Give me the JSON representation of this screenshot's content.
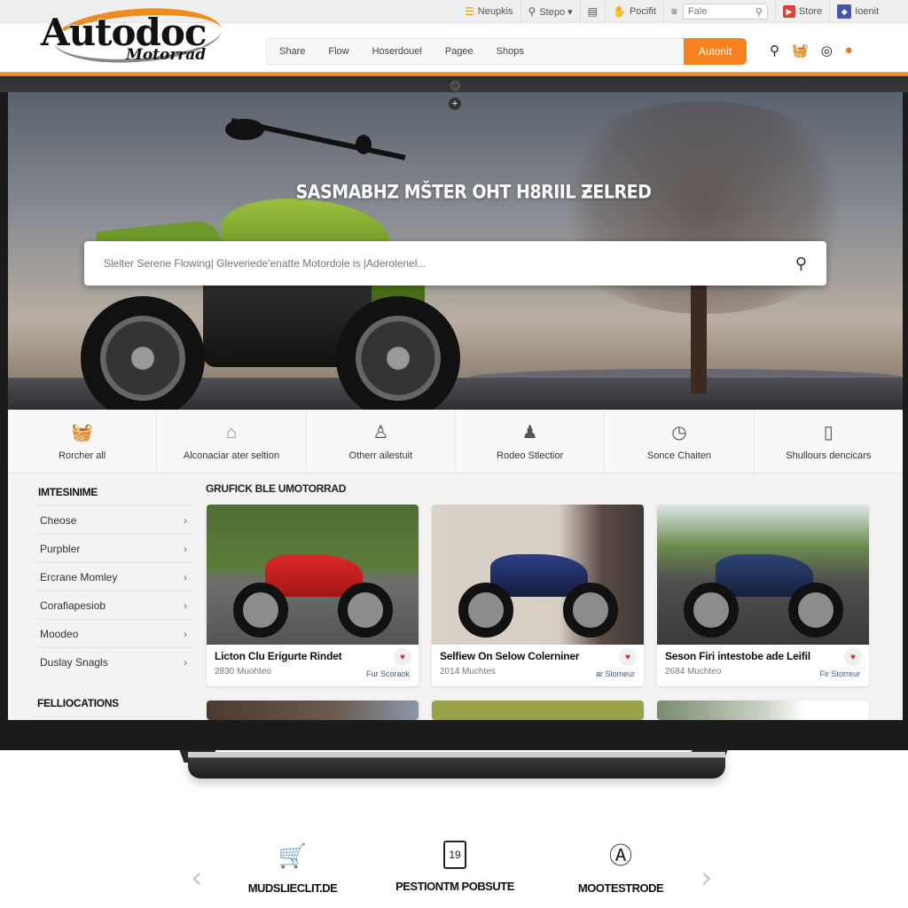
{
  "brand": {
    "name": "Autodoc",
    "subname": "Motorrad",
    "accent": "#f4831f"
  },
  "utility_bar": {
    "items": [
      {
        "icon": "list-icon",
        "label": "Neupkis"
      },
      {
        "icon": "search-icon",
        "label": "Stepo ▾"
      },
      {
        "icon": "card-icon",
        "label": ""
      },
      {
        "icon": "hand-icon",
        "label": "Pocifit"
      },
      {
        "icon": "menu-icon",
        "label": ""
      }
    ],
    "search": {
      "value": "Fale",
      "icon": "search-icon"
    },
    "store_label": "Store",
    "account_label": "Ioenit"
  },
  "header": {
    "nav": [
      "Share",
      "Flow",
      "Hoserdouel",
      "Pagee",
      "Shops"
    ],
    "cta_label": "Autonit",
    "icons": [
      "search-icon",
      "basket-icon",
      "user-badge-icon",
      "helmet-icon"
    ]
  },
  "hero": {
    "title": "SASMABHZ MŠTER OHT H8RIIL ƵELRED",
    "search_placeholder": "Slelter Serene Flowing| Gleveriede'enatte Motordole is |Aderolenel..."
  },
  "quick_links": [
    {
      "icon": "basket-icon",
      "label": "Rorcher all"
    },
    {
      "icon": "house-icon",
      "label": "Alconaciar ater seltion"
    },
    {
      "icon": "user-outline-icon",
      "label": "Otherr ailestuit"
    },
    {
      "icon": "user-filled-icon",
      "label": "Rodeo Stlectior"
    },
    {
      "icon": "clock-icon",
      "label": "Sonce Chaiten"
    },
    {
      "icon": "phone-icon",
      "label": "Shullours dencicars"
    }
  ],
  "sidebar": {
    "heading": "IMTESINIME",
    "items": [
      "Cheose",
      "Purpbler",
      "Ercrane Momley",
      "Corafiapesiob",
      "Moodeo",
      "Duslay Snagls"
    ],
    "heading2": "FELLIOCATIONS"
  },
  "grid": {
    "title": "GRUFICK BLE UMOTORRAD",
    "cards": [
      {
        "title": "Licton Clu Erigurte Rindet",
        "subtitle": "2830 Muohteo",
        "link": "Fur Scoraok",
        "image": "red-sport-motorcycle"
      },
      {
        "title": "Selfiew On Selow Colerniner",
        "subtitle": "2014 Muchtes",
        "link": "ar Slomeur",
        "image": "blue-naked-motorcycle-garage"
      },
      {
        "title": "Seson Firi intestobe ade Leifil",
        "subtitle": "2684 Muchteo",
        "link": "Fir Storreur",
        "image": "blue-retro-motorcycle-road"
      }
    ]
  },
  "features": [
    {
      "icon": "cart-icon",
      "label": "MUDSLIECLIT.DE"
    },
    {
      "icon": "calendar-icon",
      "label": "PESTIONTM POBSUTE",
      "icon_text": "19"
    },
    {
      "icon": "emblem-icon",
      "label": "MOOTESTRODE"
    }
  ]
}
